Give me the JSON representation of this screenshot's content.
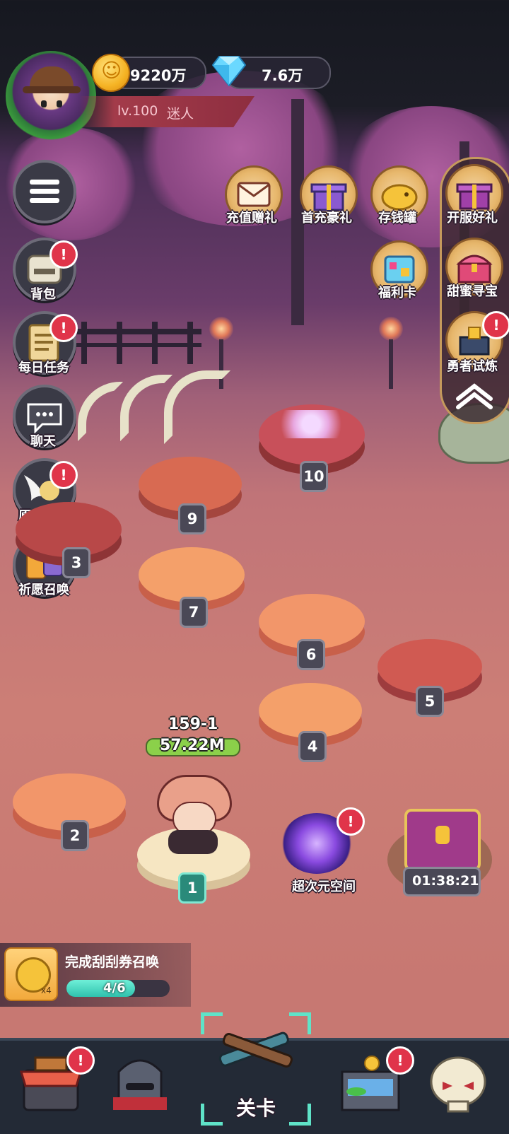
{
  "player": {
    "level": "lv.100",
    "name": "迷人"
  },
  "currency": {
    "gold": "9220万",
    "diamond": "7.6万"
  },
  "left_menu": [
    {
      "label": "背包",
      "badge": true
    },
    {
      "label": "每日任务",
      "badge": true
    },
    {
      "label": "聊天",
      "badge": false
    },
    {
      "label": "原力觉醒",
      "badge": true
    },
    {
      "label": "祈愿召唤",
      "badge": true
    }
  ],
  "right_icons": {
    "recharge_gift": "充值赠礼",
    "first_recharge": "首充豪礼",
    "piggy_bank": "存钱罐",
    "welfare_card": "福利卡",
    "server_gift": "开服好礼",
    "sweet_treasure": "甜蜜寻宝",
    "hero_trial": "勇者试炼"
  },
  "stages": [
    "1",
    "2",
    "3",
    "4",
    "5",
    "6",
    "7",
    "9",
    "10"
  ],
  "hero": {
    "stage": "159-1",
    "power": "57.22M"
  },
  "portal": {
    "label": "超次元空间"
  },
  "chest": {
    "timer": "01:38:21"
  },
  "quest": {
    "title": "完成刮刮券召唤",
    "count": "x4",
    "progress_text": "4/6",
    "progress": 0.667
  },
  "nav": {
    "selected_label": "关卡"
  },
  "colors": {
    "accent": "#5fe3c8",
    "badge": "#e0344a",
    "gold": "#f5b324"
  }
}
